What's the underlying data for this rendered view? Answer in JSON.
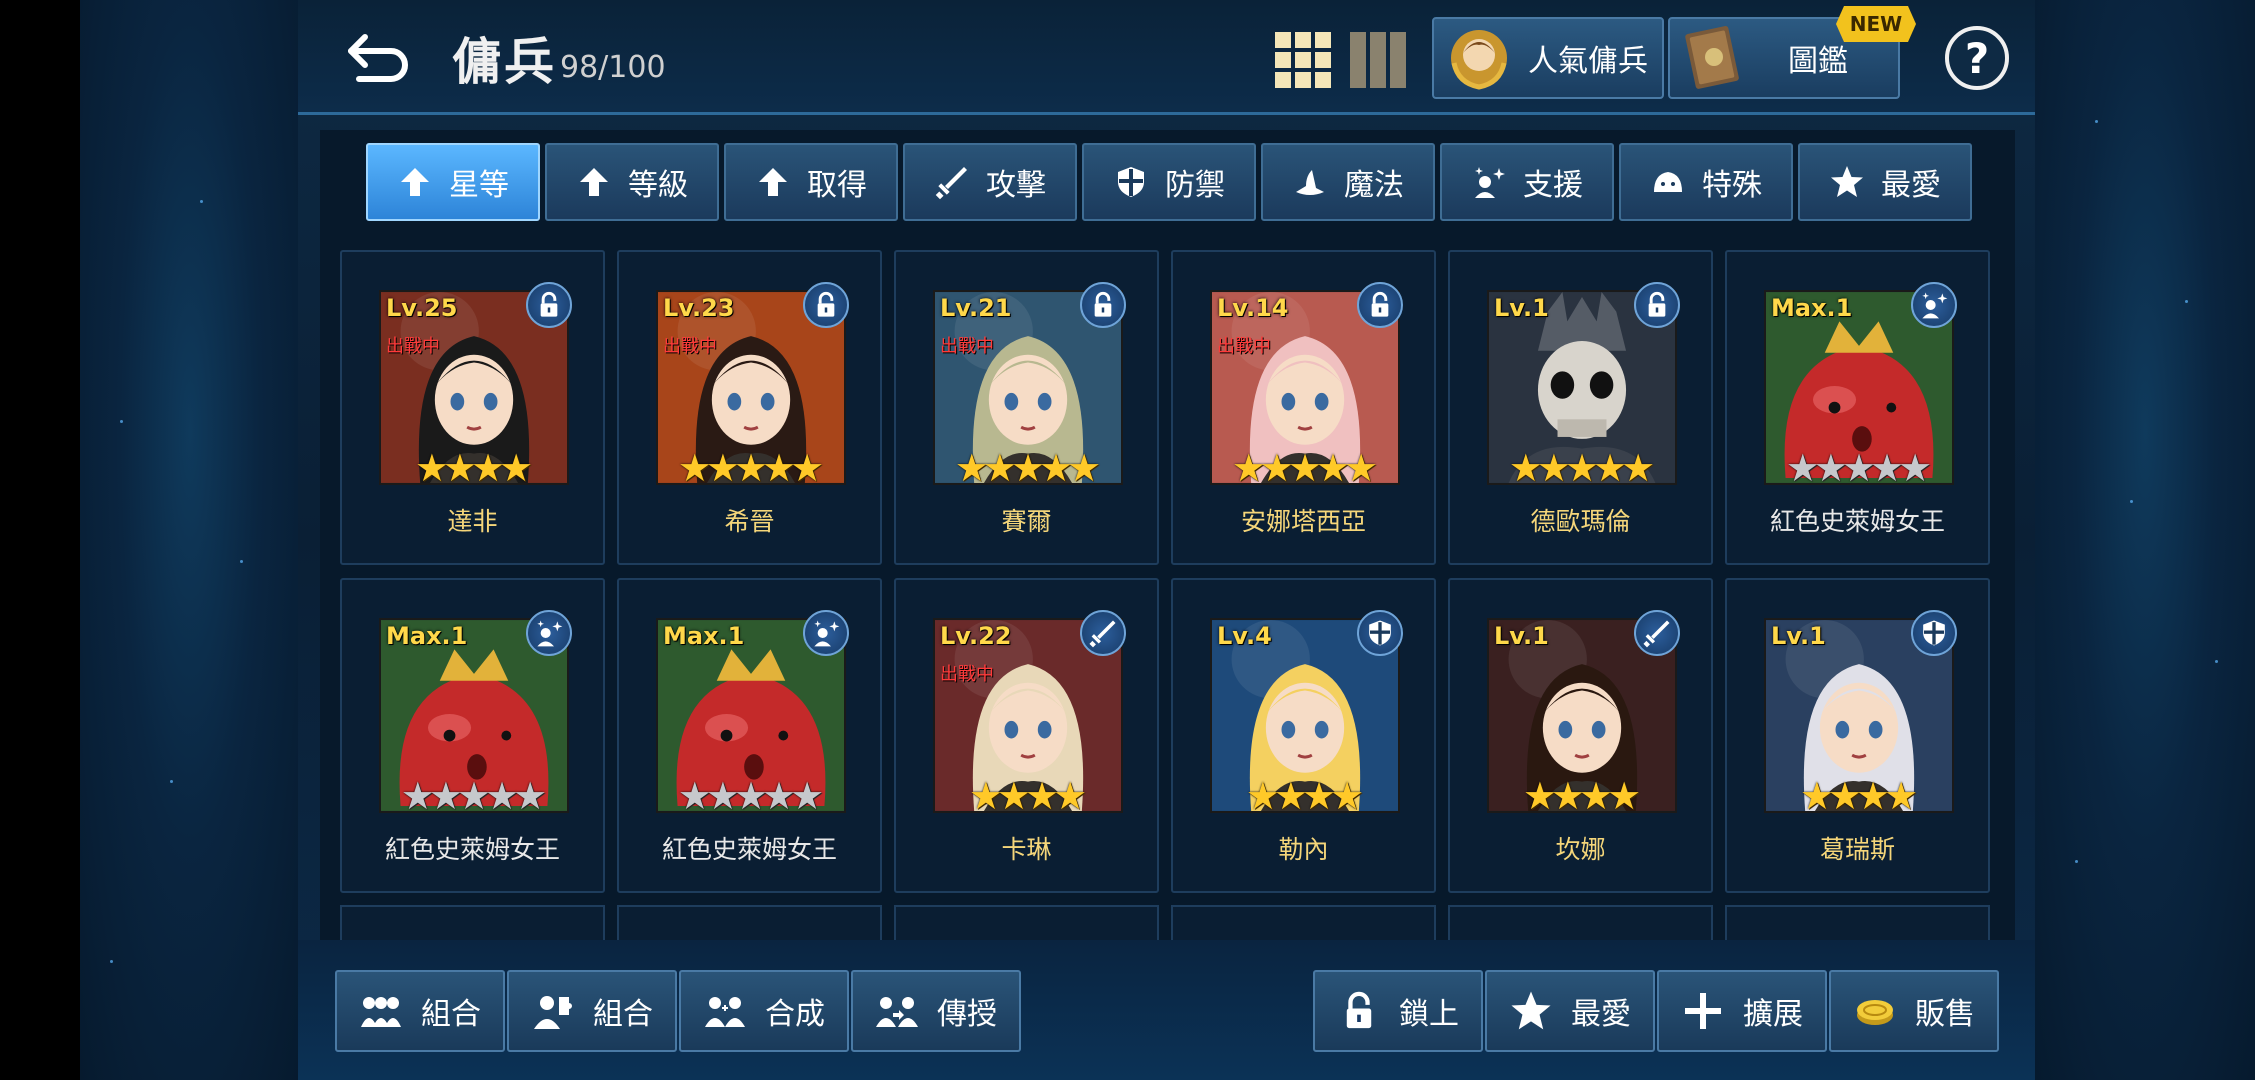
{
  "header": {
    "title": "傭兵",
    "count": "98/100",
    "popular_label": "人氣傭兵",
    "codex_label": "圖鑑",
    "new_badge": "NEW",
    "help": "?"
  },
  "sort_tabs": [
    {
      "label": "星等",
      "icon": "arrow-up-icon",
      "active": true
    },
    {
      "label": "等級",
      "icon": "arrow-up-icon",
      "active": false
    },
    {
      "label": "取得",
      "icon": "arrow-up-icon",
      "active": false
    },
    {
      "label": "攻擊",
      "icon": "sword-icon",
      "active": false
    },
    {
      "label": "防禦",
      "icon": "shield-icon",
      "active": false
    },
    {
      "label": "魔法",
      "icon": "witch-hat-icon",
      "active": false
    },
    {
      "label": "支援",
      "icon": "support-icon",
      "active": false
    },
    {
      "label": "特殊",
      "icon": "slime-icon",
      "active": false
    },
    {
      "label": "最愛",
      "icon": "star-icon",
      "active": false
    }
  ],
  "mercenaries": [
    {
      "name": "達非",
      "level": "Lv.25",
      "status": "出戰中",
      "stars": 4,
      "star_color": "gold",
      "badge": "lock-icon",
      "portrait": "#7a2e20"
    },
    {
      "name": "希晉",
      "level": "Lv.23",
      "status": "出戰中",
      "stars": 5,
      "star_color": "gold",
      "badge": "lock-icon",
      "portrait": "#a8451a"
    },
    {
      "name": "賽爾",
      "level": "Lv.21",
      "status": "出戰中",
      "stars": 5,
      "star_color": "gold",
      "badge": "lock-icon",
      "portrait": "#2f5570"
    },
    {
      "name": "安娜塔西亞",
      "level": "Lv.14",
      "status": "出戰中",
      "stars": 5,
      "star_color": "gold",
      "badge": "lock-icon",
      "portrait": "#b85a50"
    },
    {
      "name": "德歐瑪倫",
      "level": "Lv.1",
      "status": "",
      "stars": 5,
      "star_color": "gold",
      "badge": "lock-icon",
      "portrait": "#2a3340"
    },
    {
      "name": "紅色史萊姆女王",
      "level": "Max.1",
      "status": "",
      "stars": 5,
      "star_color": "silver",
      "badge": "support-icon",
      "portrait": "#c42a2a"
    },
    {
      "name": "紅色史萊姆女王",
      "level": "Max.1",
      "status": "",
      "stars": 5,
      "star_color": "silver",
      "badge": "support-icon",
      "portrait": "#c42a2a"
    },
    {
      "name": "紅色史萊姆女王",
      "level": "Max.1",
      "status": "",
      "stars": 5,
      "star_color": "silver",
      "badge": "support-icon",
      "portrait": "#c42a2a"
    },
    {
      "name": "卡琳",
      "level": "Lv.22",
      "status": "出戰中",
      "stars": 4,
      "star_color": "gold",
      "badge": "sword-icon",
      "portrait": "#6a2a2a"
    },
    {
      "name": "勒內",
      "level": "Lv.4",
      "status": "",
      "stars": 4,
      "star_color": "gold",
      "badge": "shield-icon",
      "portrait": "#1e4a7a"
    },
    {
      "name": "坎娜",
      "level": "Lv.1",
      "status": "",
      "stars": 4,
      "star_color": "gold",
      "badge": "sword-icon",
      "portrait": "#3a2020"
    },
    {
      "name": "葛瑞斯",
      "level": "Lv.1",
      "status": "",
      "stars": 4,
      "star_color": "gold",
      "badge": "shield-icon",
      "portrait": "#2a4060"
    }
  ],
  "bottom_left": [
    {
      "label": "組合",
      "icon": "team-icon"
    },
    {
      "label": "組合",
      "icon": "puzzle-person-icon"
    },
    {
      "label": "合成",
      "icon": "merge-icon"
    },
    {
      "label": "傳授",
      "icon": "transfer-icon"
    }
  ],
  "bottom_right": [
    {
      "label": "鎖上",
      "icon": "lock-icon"
    },
    {
      "label": "最愛",
      "icon": "star-icon"
    },
    {
      "label": "擴展",
      "icon": "plus-icon"
    },
    {
      "label": "販售",
      "icon": "coin-icon"
    }
  ],
  "colors": {
    "accent_gold": "#f5d67a",
    "level_yellow": "#ffd84a",
    "active_tab": "#3a9af0",
    "panel_bg": "#0a1f35"
  }
}
